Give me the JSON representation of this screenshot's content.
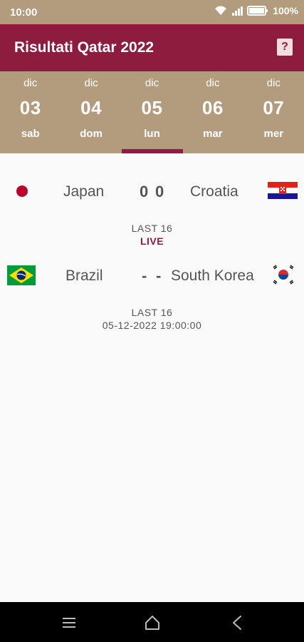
{
  "status_bar": {
    "time": "10:00",
    "battery": "100%"
  },
  "app_bar": {
    "title": "Risultati Qatar 2022",
    "help_glyph": "?"
  },
  "dates": [
    {
      "month": "dic",
      "day": "03",
      "weekday": "sab"
    },
    {
      "month": "dic",
      "day": "04",
      "weekday": "dom"
    },
    {
      "month": "dic",
      "day": "05",
      "weekday": "lun"
    },
    {
      "month": "dic",
      "day": "06",
      "weekday": "mar"
    },
    {
      "month": "dic",
      "day": "07",
      "weekday": "mer"
    }
  ],
  "selected_date_index": 2,
  "matches": [
    {
      "home": "Japan",
      "away": "Croatia",
      "home_score": "0",
      "away_score": "0",
      "round": "LAST  16",
      "status": "LIVE",
      "home_flag": "japan-flag",
      "away_flag": "croatia-flag"
    },
    {
      "home": "Brazil",
      "away": "South Korea",
      "home_score": "-",
      "away_score": "-",
      "round": "LAST  16",
      "kickoff": "05-12-2022 19:00:00",
      "home_flag": "brazil-flag",
      "away_flag": "south-korea-flag"
    }
  ],
  "colors": {
    "primary": "#8e1c3e",
    "accent": "#b29c7d",
    "background": "#fafafa"
  }
}
